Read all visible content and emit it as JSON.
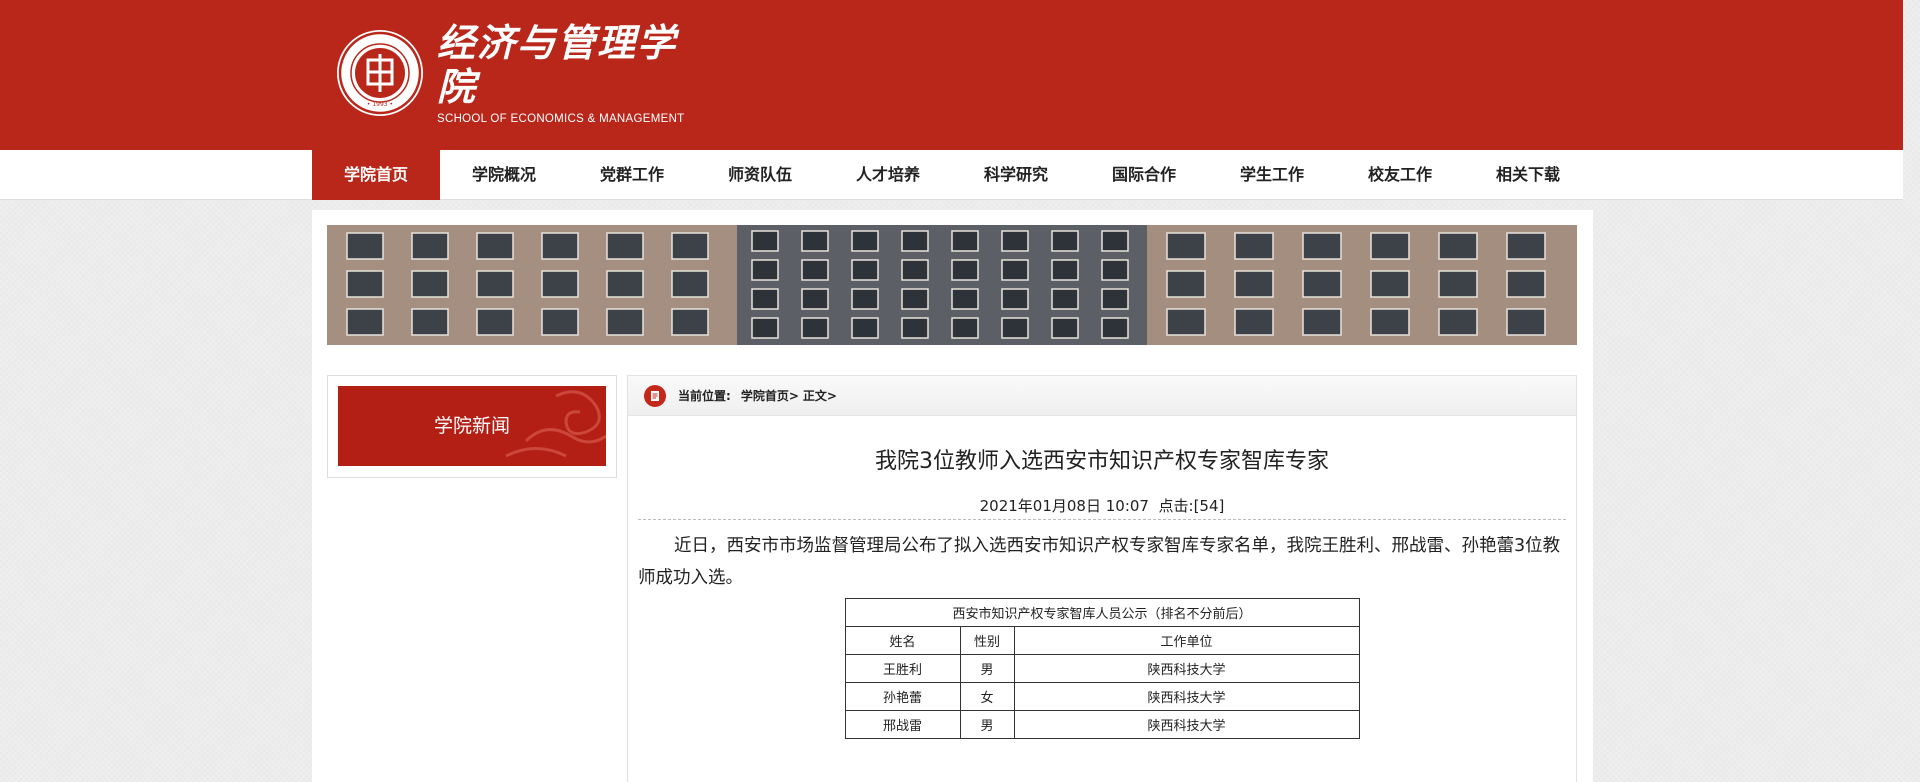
{
  "header": {
    "logo_cn": "经济与管理学院",
    "logo_en": "SCHOOL OF ECONOMICS & MANAGEMENT",
    "seal_year": "1993",
    "brand_color": "#b9271b"
  },
  "nav": {
    "items": [
      "学院首页",
      "学院概况",
      "党群工作",
      "师资队伍",
      "人才培养",
      "科学研究",
      "国际合作",
      "学生工作",
      "校友工作",
      "相关下载"
    ],
    "active_index": 0
  },
  "sidebar": {
    "title": "学院新闻"
  },
  "breadcrumb": {
    "label": "当前位置:",
    "items": [
      "学院首页>",
      "正文>"
    ]
  },
  "article": {
    "title": "我院3位教师入选西安市知识产权专家智库专家",
    "date": "2021年01月08日 10:07",
    "clicks_label": "点击:",
    "clicks": "[54]",
    "body": "近日，西安市市场监督管理局公布了拟入选西安市知识产权专家智库专家名单，我院王胜利、邢战雷、孙艳蕾3位教师成功入选。"
  },
  "table": {
    "caption": "西安市知识产权专家智库人员公示（排名不分前后）",
    "headers": [
      "姓名",
      "性别",
      "工作单位"
    ],
    "rows": [
      [
        "王胜利",
        "男",
        "陕西科技大学"
      ],
      [
        "孙艳蕾",
        "女",
        "陕西科技大学"
      ],
      [
        "邢战雷",
        "男",
        "陕西科技大学"
      ]
    ]
  }
}
